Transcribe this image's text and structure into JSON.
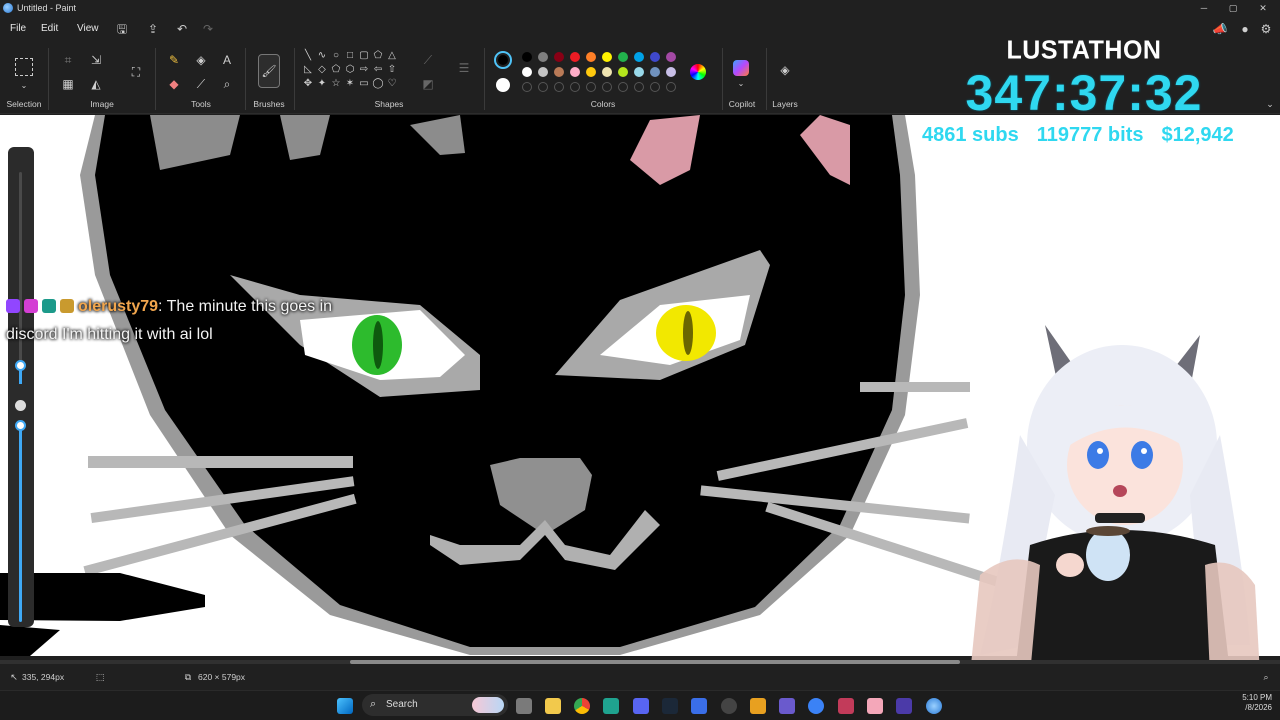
{
  "window": {
    "title": "Untitled - Paint",
    "min": "─",
    "max": "▢",
    "close": "✕"
  },
  "menu": {
    "file": "File",
    "edit": "Edit",
    "view": "View"
  },
  "ribbon": {
    "groups": {
      "selection": "Selection",
      "image": "Image",
      "tools": "Tools",
      "brushes": "Brushes",
      "shapes": "Shapes",
      "colors": "Colors",
      "copilot": "Copilot",
      "layers": "Layers"
    },
    "palette_row1": [
      "#000000",
      "#7f7f7f",
      "#880015",
      "#ed1c24",
      "#ff7f27",
      "#fff200",
      "#22b14c",
      "#00a2e8",
      "#3f48cc",
      "#a349a4"
    ],
    "palette_row2": [
      "#ffffff",
      "#c3c3c3",
      "#b97a57",
      "#ffaec9",
      "#ffc90e",
      "#efe4b0",
      "#b5e61d",
      "#99d9ea",
      "#7092be",
      "#c8bfe7"
    ],
    "primary_color": "#000000",
    "secondary_color": "#ffffff"
  },
  "overlay": {
    "title": "LUSTATHON",
    "timer": "347:37:32",
    "subs": "4861 subs",
    "bits": "119777 bits",
    "money": "$12,942",
    "accent": "#2fd8f0"
  },
  "chat": {
    "username": "olerusty79",
    "message_line1": ": The minute this goes in",
    "message_line2": "discord I'm hitting it with ai lol"
  },
  "status": {
    "cursor_pos": "335, 294px",
    "canvas_size": "620 × 579px"
  },
  "taskbar": {
    "search_placeholder": "Search",
    "time": "5:10 PM",
    "date": "/8/2026"
  }
}
